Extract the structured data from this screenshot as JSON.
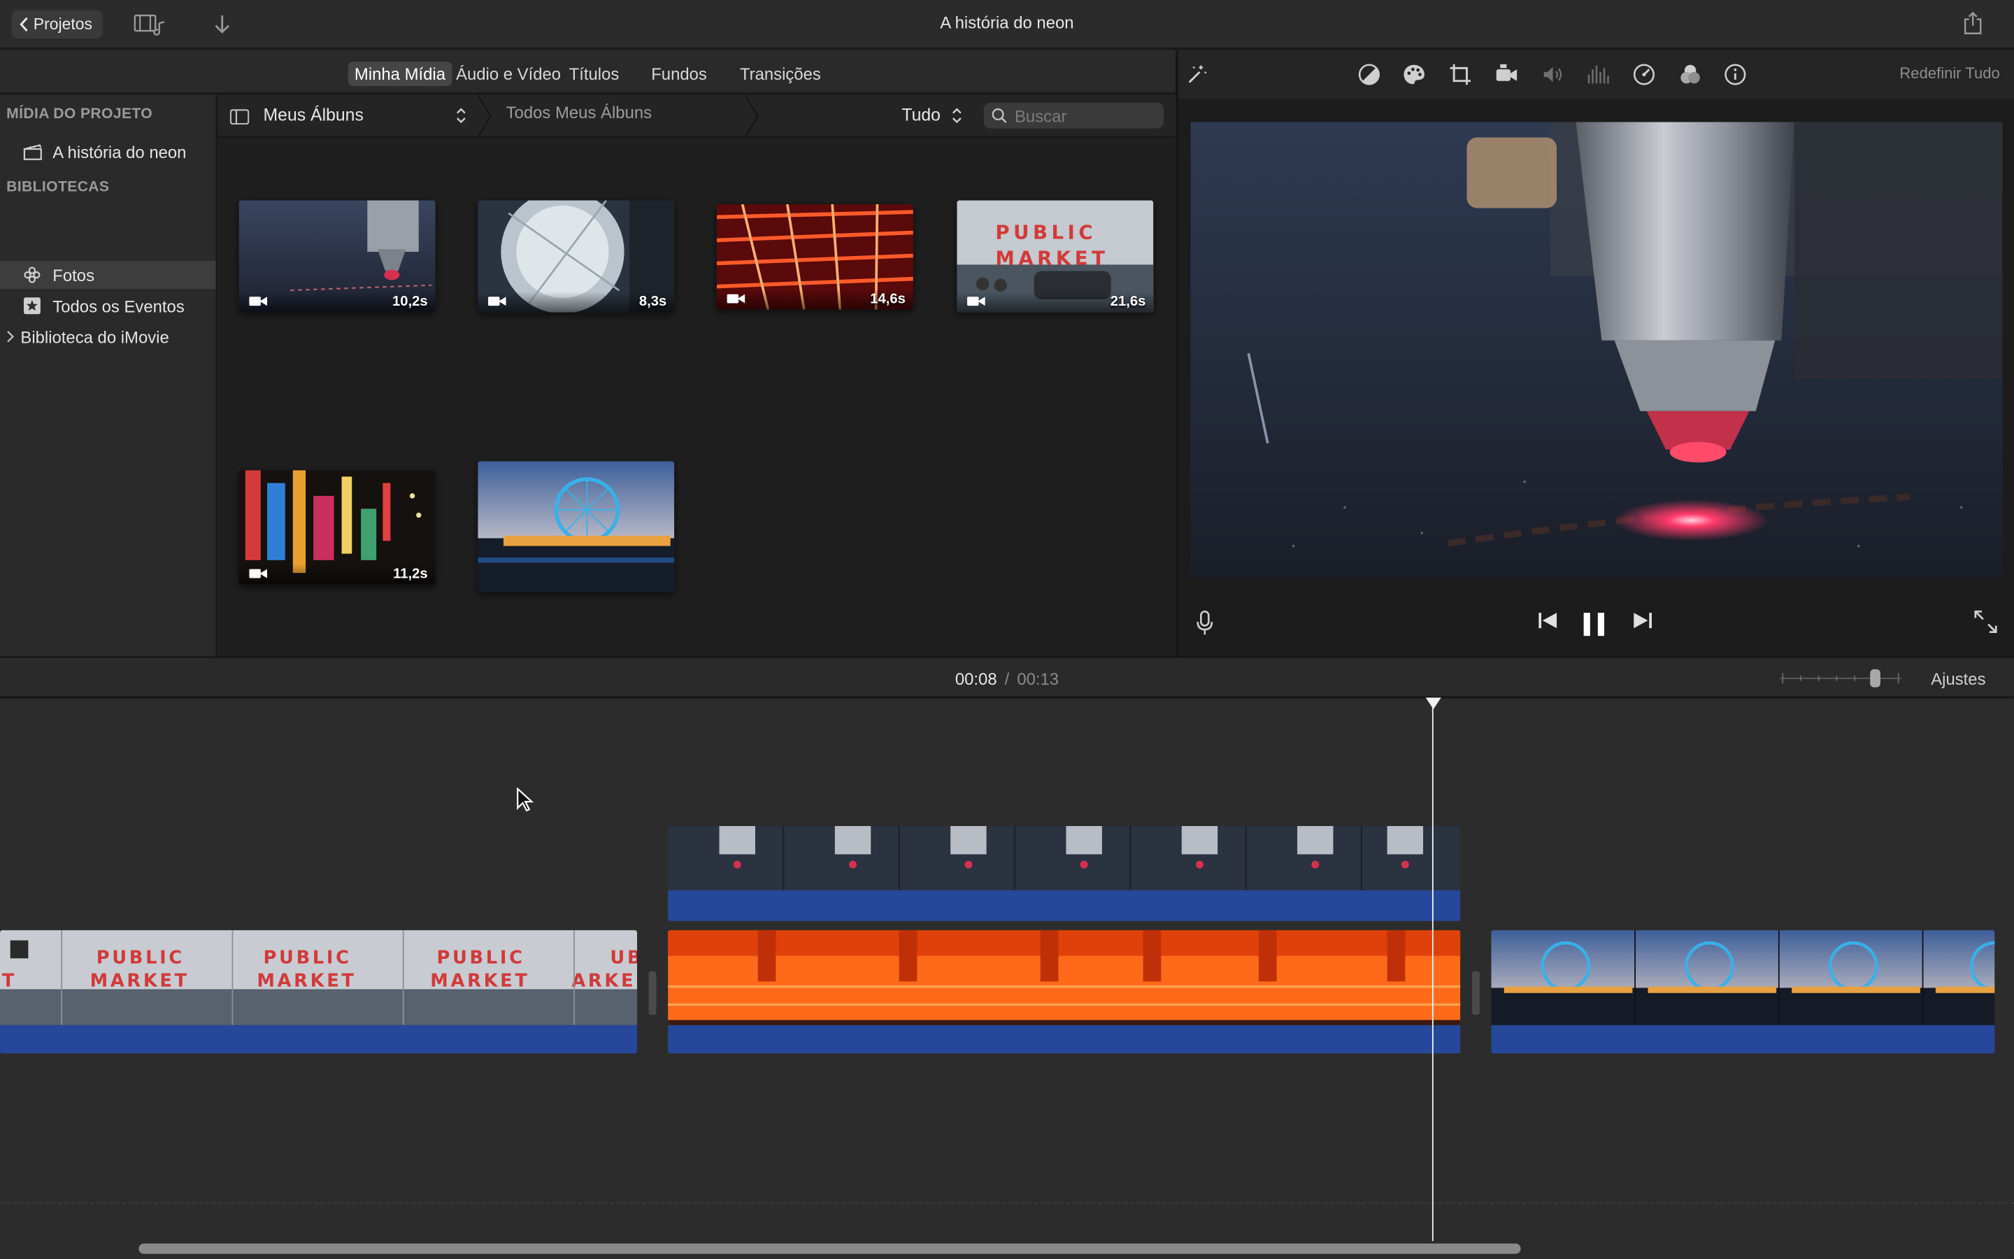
{
  "titlebar": {
    "projects_button": "Projetos",
    "title": "A história do neon"
  },
  "tabs": [
    "Minha Mídia",
    "Áudio e Vídeo",
    "Títulos",
    "Fundos",
    "Transições"
  ],
  "sidebar": {
    "project_media_header": "MÍDIA DO PROJETO",
    "project_item": "A história do neon",
    "libraries_header": "BIBLIOTECAS",
    "library_items": [
      "Fotos",
      "Todos os Eventos",
      "Biblioteca do iMovie"
    ]
  },
  "browser": {
    "album_selector": "Meus Álbuns",
    "breadcrumb": "Todos Meus Álbuns",
    "filter": "Tudo",
    "search_placeholder": "Buscar",
    "clips": [
      {
        "duration": "10,2s",
        "subject": "laser-cutter"
      },
      {
        "duration": "8,3s",
        "subject": "glass-tube"
      },
      {
        "duration": "14,6s",
        "subject": "neon-grid"
      },
      {
        "duration": "21,6s",
        "subject": "public-market"
      },
      {
        "duration": "11,2s",
        "subject": "city-signs"
      },
      {
        "duration": "",
        "subject": "ferris-wheel"
      }
    ]
  },
  "viewer": {
    "reset_all": "Redefinir Tudo"
  },
  "timeline": {
    "current_time": "00:08",
    "separator": "/",
    "total_time": "00:13",
    "settings": "Ajustes",
    "zoom_level": 0.75
  },
  "colors": {
    "accent_audio": "#26489a",
    "background": "#1e1e1e",
    "panel": "#2a2a2a"
  }
}
